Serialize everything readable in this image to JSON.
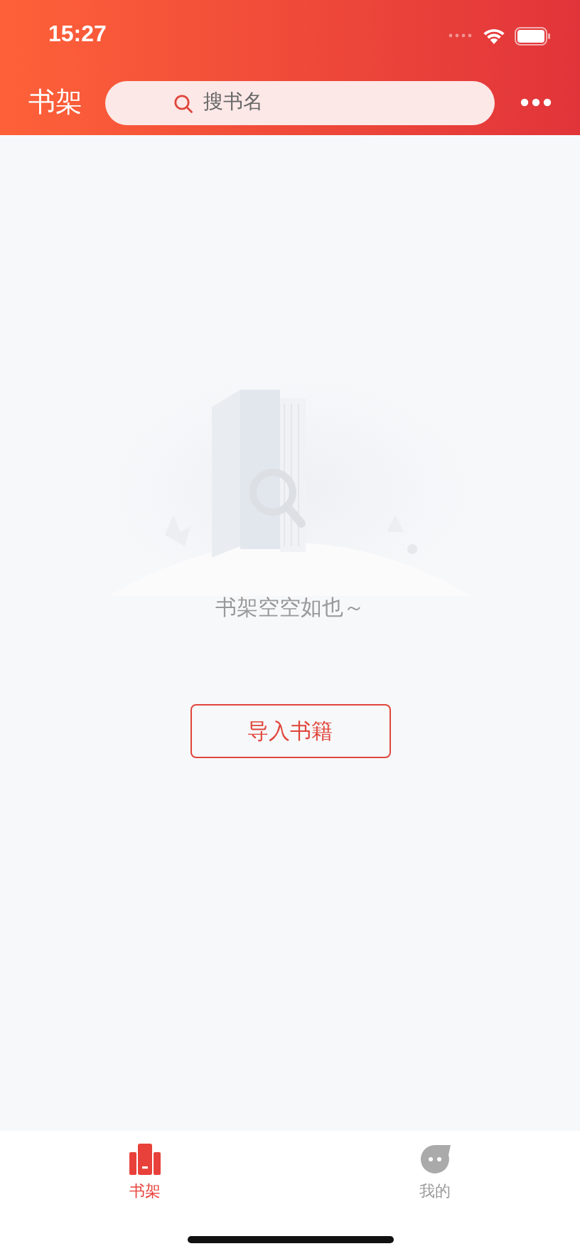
{
  "status_bar": {
    "time": "15:27"
  },
  "header": {
    "title": "书架",
    "search": {
      "placeholder": "搜书名"
    }
  },
  "empty_state": {
    "message": "书架空空如也～",
    "button": "导入书籍"
  },
  "tab_bar": [
    {
      "label": "书架",
      "kind": "shelf",
      "selected": true
    },
    {
      "label": "我的",
      "kind": "profile",
      "selected": false
    }
  ]
}
